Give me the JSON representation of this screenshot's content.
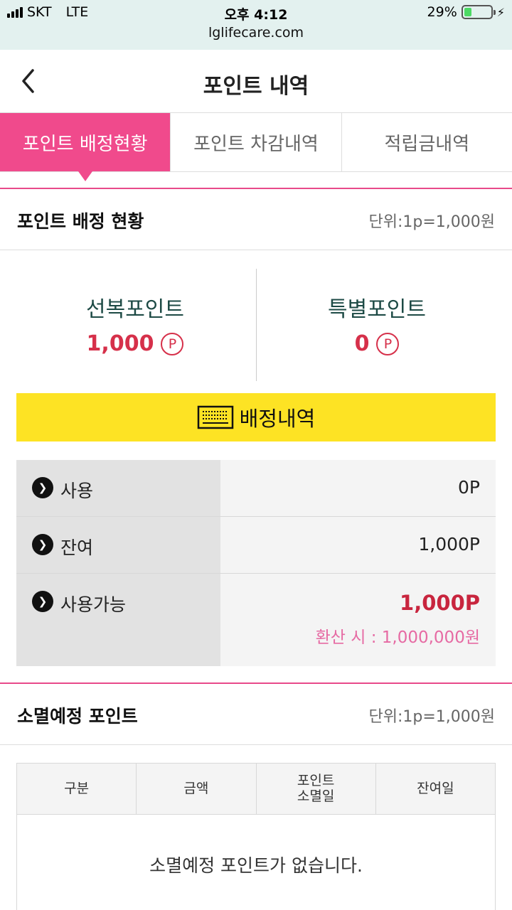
{
  "status_bar": {
    "carrier": "SKT",
    "network": "LTE",
    "time": "오후 4:12",
    "battery": "29%",
    "battery_level": 0.29
  },
  "browser": {
    "url": "lglifecare.com"
  },
  "header": {
    "title": "포인트 내역",
    "back_icon": "chevron-left-icon"
  },
  "tabs": [
    {
      "label": "포인트 배정현황",
      "active": true
    },
    {
      "label": "포인트 차감내역",
      "active": false
    },
    {
      "label": "적립금내역",
      "active": false
    }
  ],
  "allocation": {
    "title": "포인트 배정 현황",
    "unit": "단위:1p=1,000원",
    "points": [
      {
        "label": "선복포인트",
        "value": "1,000",
        "symbol": "P"
      },
      {
        "label": "특별포인트",
        "value": "0",
        "symbol": "P"
      }
    ],
    "button_label": "배정내역",
    "button_icon": "keyboard-icon",
    "usage": [
      {
        "label": "사용",
        "value": "0P"
      },
      {
        "label": "잔여",
        "value": "1,000P"
      },
      {
        "label": "사용가능",
        "value": "1,000P",
        "sub": "환산 시 : 1,000,000원"
      }
    ]
  },
  "expiry": {
    "title": "소멸예정 포인트",
    "unit": "단위:1p=1,000원",
    "columns": [
      "구분",
      "금액",
      "포인트\n소멸일",
      "잔여일"
    ],
    "empty_message": "소멸예정 포인트가 없습니다."
  },
  "colors": {
    "accent": "#f04a8c",
    "value_red": "#d6304a",
    "button_yellow": "#fde324",
    "sub_pink": "#e66aa3"
  }
}
